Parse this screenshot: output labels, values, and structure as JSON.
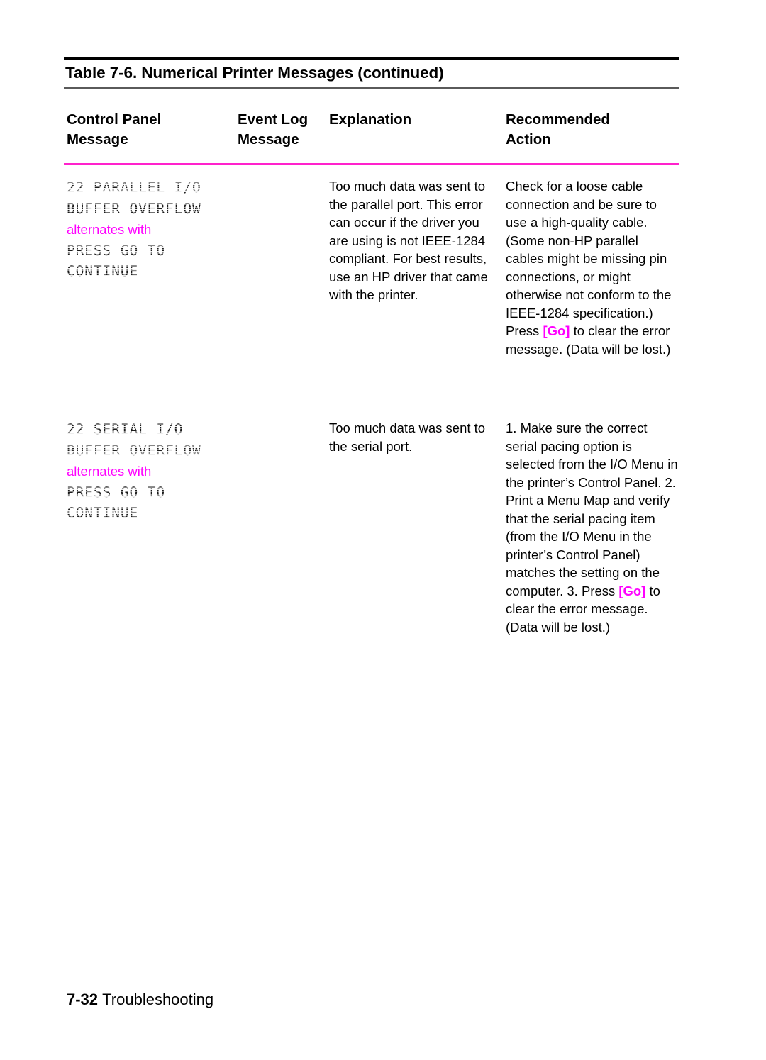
{
  "table": {
    "caption": "Table 7-6.  Numerical Printer Messages (continued)",
    "rule_color_top": "#000000",
    "rule_color_caption": "#5a5a5a",
    "rule_color_header": "#ff22cc",
    "accent_color": "#ff00ff",
    "headers": {
      "control_panel": [
        "Control Panel",
        "Message"
      ],
      "event_log": [
        "Event Log",
        "Message"
      ],
      "explanation": [
        "Explanation"
      ],
      "recommended_action": [
        "Recommended",
        "Action"
      ]
    },
    "rows": [
      {
        "control_panel": {
          "lines_before": [
            "22 PARALLEL I/O",
            "BUFFER OVERFLOW"
          ],
          "alternates_label": "alternates with",
          "lines_after": [
            "PRESS GO TO",
            "CONTINUE"
          ]
        },
        "event_log": "",
        "explanation": "Too much data was sent to the parallel port. This error can occur if the driver you are using is not IEEE-1284 compliant. For best results, use an HP driver that came with the printer.",
        "recommended_action_pre": "Check for a loose cable connection and be sure to use a high-quality cable. (Some non-HP parallel cables might be missing pin connections, or might otherwise not conform to the IEEE-1284 specification.) Press ",
        "recommended_action_key": "[Go]",
        "recommended_action_post": " to clear the error message. (Data will be lost.)"
      },
      {
        "control_panel": {
          "lines_before": [
            "22 SERIAL I/O",
            "BUFFER OVERFLOW"
          ],
          "alternates_label": "alternates with",
          "lines_after": [
            "PRESS GO TO",
            "CONTINUE"
          ]
        },
        "event_log": "",
        "explanation": "Too much data was sent to the serial port.",
        "recommended_action_pre": "1. Make sure the correct serial pacing option is selected from the I/O Menu in the printer’s Control Panel. 2. Print a Menu Map and verify that the serial pacing item (from the I/O Menu in the printer’s Control Panel) matches the setting on the computer. 3. Press ",
        "recommended_action_key": "[Go]",
        "recommended_action_post": " to clear the error message. (Data will be lost.)"
      }
    ]
  },
  "footer": {
    "page_number": "7-32",
    "section": "Troubleshooting"
  }
}
